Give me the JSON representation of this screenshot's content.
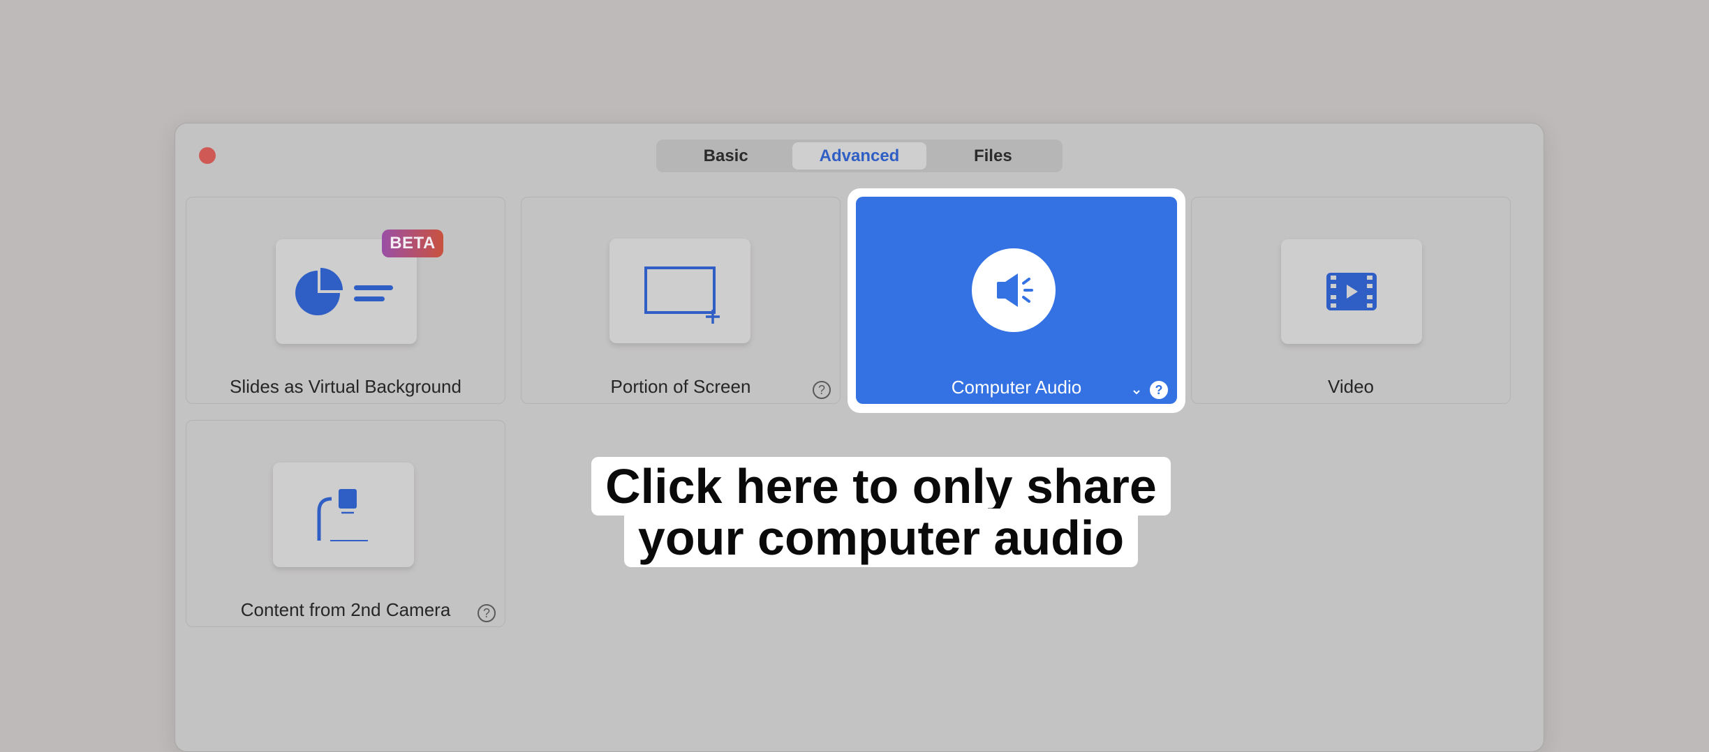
{
  "tabs": [
    {
      "label": "Basic",
      "active": false
    },
    {
      "label": "Advanced",
      "active": true
    },
    {
      "label": "Files",
      "active": false
    }
  ],
  "tiles": {
    "slides": {
      "label": "Slides as Virtual Background",
      "badge": "BETA",
      "icon": "pie-chart-slides-icon"
    },
    "portion": {
      "label": "Portion of Screen",
      "icon": "screen-portion-icon",
      "help": "?"
    },
    "audio": {
      "label": "Computer Audio",
      "icon": "speaker-icon",
      "help": "?",
      "selected": true
    },
    "video": {
      "label": "Video",
      "icon": "film-play-icon"
    },
    "camera": {
      "label": "Content from 2nd Camera",
      "icon": "document-camera-icon",
      "help": "?"
    }
  },
  "callout": {
    "line1": "Click here to only share",
    "line2": "your computer audio"
  },
  "colors": {
    "accent": "#3472e4",
    "icon_blue": "#2f5fc4",
    "close": "#cf5a55"
  }
}
